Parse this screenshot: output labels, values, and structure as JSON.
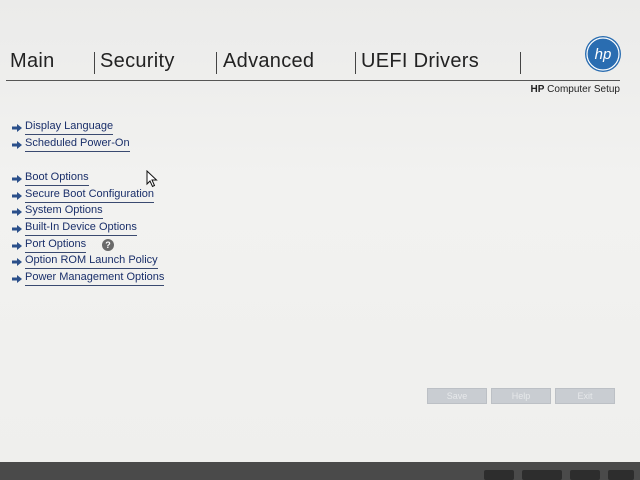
{
  "tabs": [
    {
      "label": "Main"
    },
    {
      "label": "Security"
    },
    {
      "label": "Advanced"
    },
    {
      "label": "UEFI Drivers"
    }
  ],
  "active_tab": "Advanced",
  "logo": {
    "text": "hp",
    "icon": "hp-logo-icon",
    "color": "#2a6db1"
  },
  "subtitle": {
    "brand": "HP",
    "text": "Computer Setup"
  },
  "menu": {
    "items": [
      {
        "label": "Display Language"
      },
      {
        "label": "Scheduled Power-On"
      },
      {
        "label": "Boot Options"
      },
      {
        "label": "Secure Boot Configuration"
      },
      {
        "label": "System Options"
      },
      {
        "label": "Built-In Device Options"
      },
      {
        "label": "Port Options",
        "help": "?"
      },
      {
        "label": "Option ROM Launch Policy"
      },
      {
        "label": "Power Management Options"
      }
    ]
  },
  "buttons": {
    "save": "Save",
    "help": "Help",
    "exit": "Exit"
  },
  "colors": {
    "link": "#1a2f6a",
    "accent": "#2a6db1",
    "button_disabled": "#c9cdd2"
  }
}
